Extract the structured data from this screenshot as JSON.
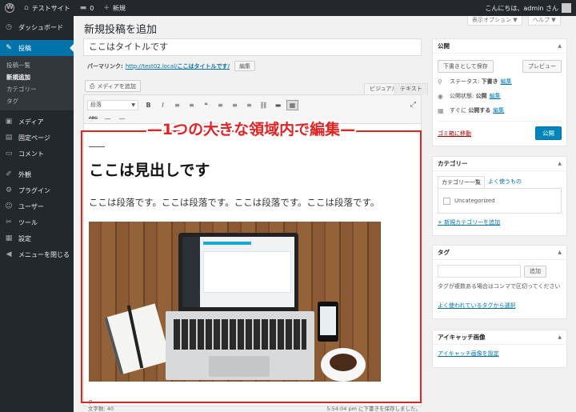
{
  "adminbar": {
    "site_name": "テストサイト",
    "comment_count": "0",
    "new_label": "新規",
    "greeting": "こんにちは、admin さん"
  },
  "screen_tabs": {
    "screen_options": "表示オプション ▼",
    "help": "ヘルプ ▼"
  },
  "sidebar": {
    "items": [
      {
        "icon": "◷",
        "label": "ダッシュボード"
      },
      {
        "icon": "✎",
        "label": "投稿"
      },
      {
        "icon": "▣",
        "label": "メディア"
      },
      {
        "icon": "▤",
        "label": "固定ページ"
      },
      {
        "icon": "▭",
        "label": "コメント"
      },
      {
        "icon": "✐",
        "label": "外観"
      },
      {
        "icon": "⚙",
        "label": "プラグイン"
      },
      {
        "icon": "☺",
        "label": "ユーザー"
      },
      {
        "icon": "✂",
        "label": "ツール"
      },
      {
        "icon": "▦",
        "label": "設定"
      },
      {
        "icon": "◀",
        "label": "メニューを閉じる"
      }
    ],
    "submenu": [
      "投稿一覧",
      "新規追加",
      "カテゴリー",
      "タグ"
    ]
  },
  "main": {
    "page_title": "新規投稿を追加",
    "post_title": "ここはタイトルです",
    "permalink_label": "パーマリンク:",
    "permalink_base": "http://test02.local/",
    "permalink_slug": "ここはタイトルです/",
    "permalink_edit": "編集",
    "add_media": "メディアを追加",
    "tab_visual": "ビジュアル",
    "tab_text": "テキスト",
    "format_select": "段落",
    "heading": "ここは見出しです",
    "paragraph": "ここは段落です。ここは段落です。ここは段落です。ここは段落です。",
    "path": "p",
    "word_count": "文字数: 40",
    "draft_saved": "5:54:04 pm に下書きを保存しました。"
  },
  "annotation": {
    "label": "1つの大きな領域内で編集"
  },
  "toolbar": {
    "row1": [
      "B",
      "I",
      "≡",
      "≡",
      "❝",
      "≡",
      "≡",
      "≡",
      "⛓",
      "▬",
      "▦"
    ],
    "row1_names": [
      "bold-icon",
      "italic-icon",
      "bullet-list-icon",
      "numbered-list-icon",
      "quote-icon",
      "align-left-icon",
      "align-center-icon",
      "align-right-icon",
      "link-icon",
      "read-more-icon",
      "toolbar-toggle-icon"
    ],
    "row2": [
      "ABC",
      "—",
      "—"
    ],
    "row2_names": [
      "strikethrough-icon",
      "horizontal-line-icon",
      "text-color-icon"
    ],
    "fullscreen": "⤢"
  },
  "publish": {
    "title": "公開",
    "save_draft": "下書きとして保存",
    "preview": "プレビュー",
    "status_label": "ステータス:",
    "status_value": "下書き",
    "status_edit": "編集",
    "visibility_label": "公開状態:",
    "visibility_value": "公開",
    "visibility_edit": "編集",
    "schedule_label": "すぐに",
    "schedule_value": "公開する",
    "schedule_edit": "編集",
    "trash": "ゴミ箱に移動",
    "publish_button": "公開"
  },
  "categories": {
    "title": "カテゴリー",
    "tab_all": "カテゴリー一覧",
    "tab_popular": "よく使うもの",
    "item": "Uncategorized",
    "add_new": "+ 新規カテゴリーを追加"
  },
  "tags": {
    "title": "タグ",
    "add_button": "追加",
    "hint": "タグが複数ある場合はコンマで区切ってください",
    "popular_link": "よく使われているタグから選択"
  },
  "featured": {
    "title": "アイキャッチ画像",
    "set_link": "アイキャッチ画像を設定"
  },
  "colors": {
    "accent": "#0073aa",
    "annotation_red": "#e02424",
    "sidebar_bg": "#23282d"
  }
}
